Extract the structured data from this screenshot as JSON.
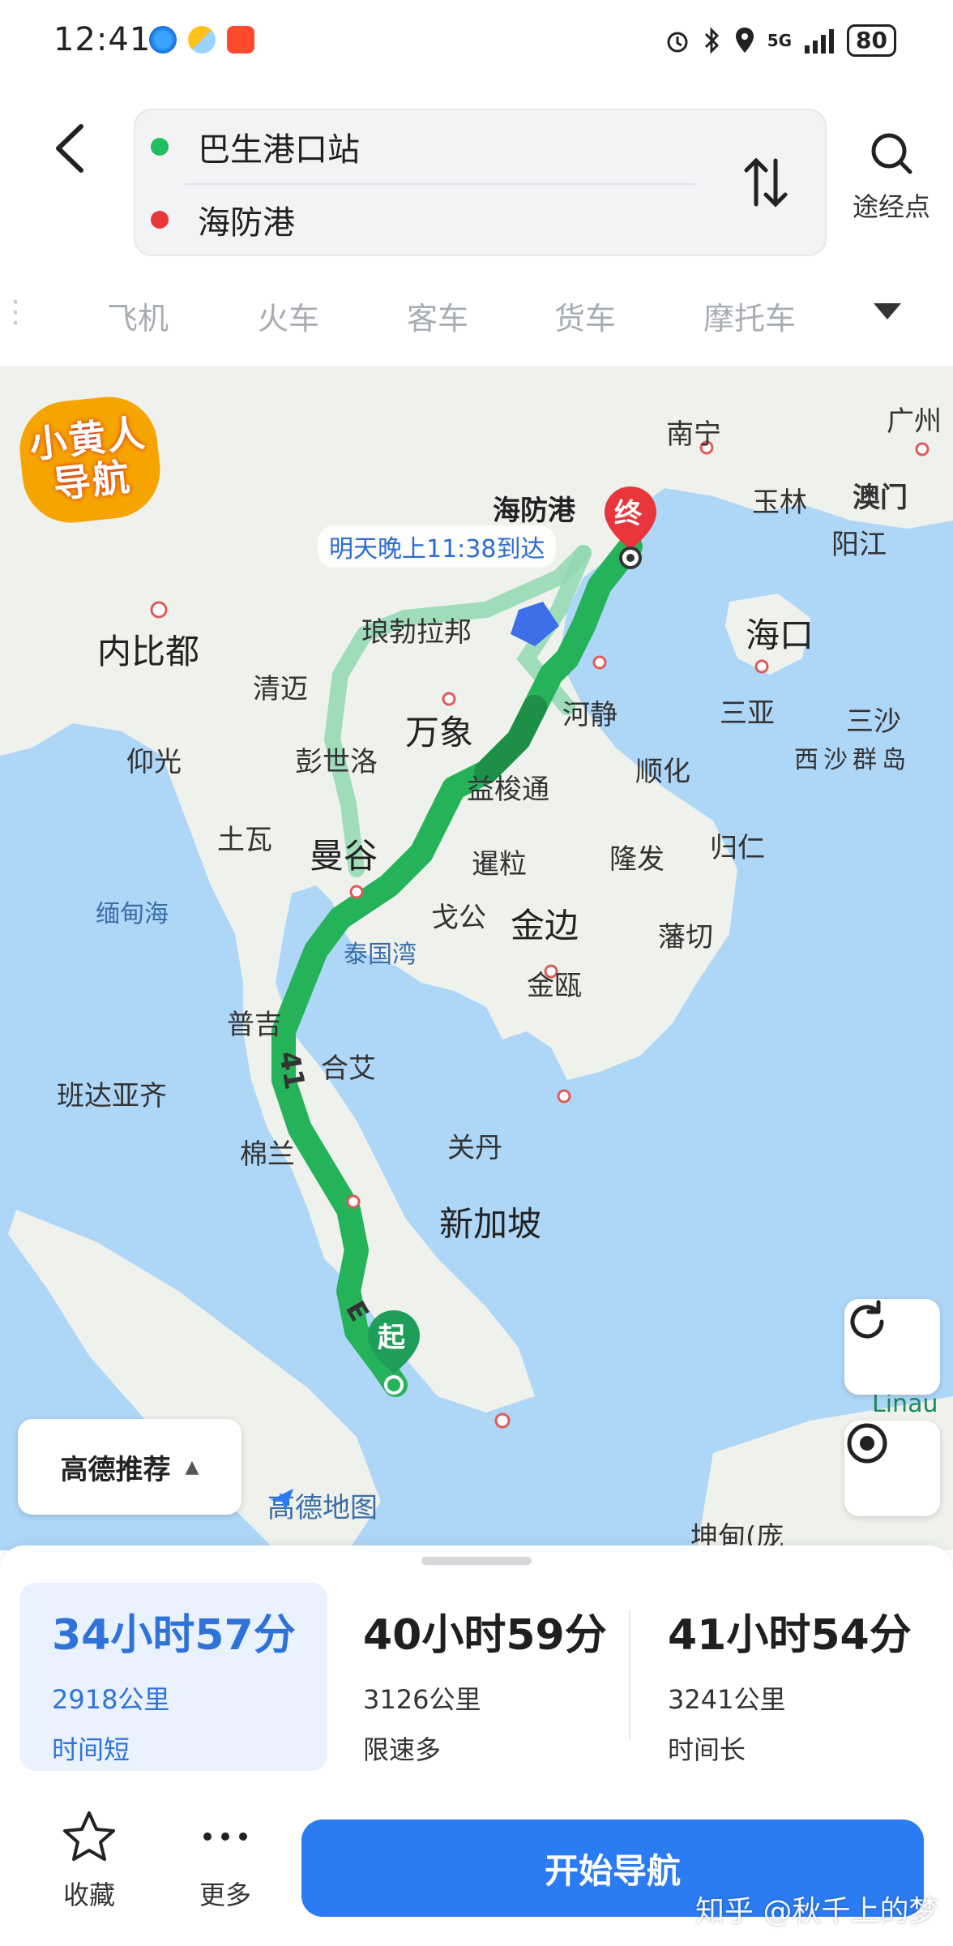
{
  "status_bar": {
    "time": "12:41",
    "network": "5G",
    "battery": "80",
    "app_icons": [
      "browser-icon",
      "weather-icon",
      "taobao-icon"
    ]
  },
  "header": {
    "start": "巴生港口站",
    "end": "海防港",
    "waypoint_label": "途经点"
  },
  "tabs": [
    {
      "label": "飞机"
    },
    {
      "label": "火车"
    },
    {
      "label": "客车"
    },
    {
      "label": "货车"
    },
    {
      "label": "摩托车"
    }
  ],
  "map": {
    "eta": "明天晚上11:38到达",
    "logo_line1": "小黄人",
    "logo_line2": "导航",
    "start_marker": "起",
    "end_marker": "终",
    "road_numbers": [
      "41",
      "E"
    ],
    "recommend_label": "高德推荐",
    "brand": "高德地图",
    "labels": {
      "haifang": "海防港",
      "nanning": "南宁",
      "guangzhou": "广州",
      "yulin": "玉林",
      "macau": "澳门",
      "yangjiang": "阳江",
      "haikou": "海口",
      "sanya": "三亚",
      "xisha": "西沙群岛",
      "sansha": "三沙",
      "naypyidaw": "内比都",
      "luang_prabang": "琅勃拉邦",
      "chiang_mai": "清迈",
      "vientiane": "万象",
      "hatinh": "河静",
      "yangon": "仰光",
      "phitsanulok": "彭世洛",
      "ubon": "益梭通",
      "hue": "顺化",
      "tavoy": "土瓦",
      "bangkok": "曼谷",
      "siem_reap": "暹粒",
      "quy_nhon": "归仁",
      "andaman": "缅甸海",
      "kampot": "戈公",
      "phnom_penh": "金边",
      "gulf_thailand": "泰国湾",
      "ca_mau": "金瓯",
      "binh_thuan": "藩切",
      "long_an": "隆发",
      "phuket": "普吉",
      "hat_yai": "合艾",
      "banda_aceh": "班达亚齐",
      "medan": "棉兰",
      "kuantan": "关丹",
      "singapore": "新加坡",
      "kuching": "坤甸(庞",
      "linau": "Linau"
    }
  },
  "routes": [
    {
      "time": "34小时57分",
      "distance": "2918公里",
      "tag": "时间短",
      "selected": true
    },
    {
      "time": "40小时59分",
      "distance": "3126公里",
      "tag": "限速多",
      "selected": false
    },
    {
      "time": "41小时54分",
      "distance": "3241公里",
      "tag": "时间长",
      "selected": false
    }
  ],
  "actions": {
    "favorite": "收藏",
    "more": "更多",
    "start_navigation": "开始导航"
  },
  "watermark": "知乎 @秋千上的梦",
  "colors": {
    "accent": "#2b7bf3",
    "route_primary": "#25b35a",
    "route_alt": "#8fd8b2",
    "start_dot": "#1fbf5f",
    "end_dot": "#e8363c",
    "sea": "#aed6f7",
    "land": "#eef1ec"
  }
}
